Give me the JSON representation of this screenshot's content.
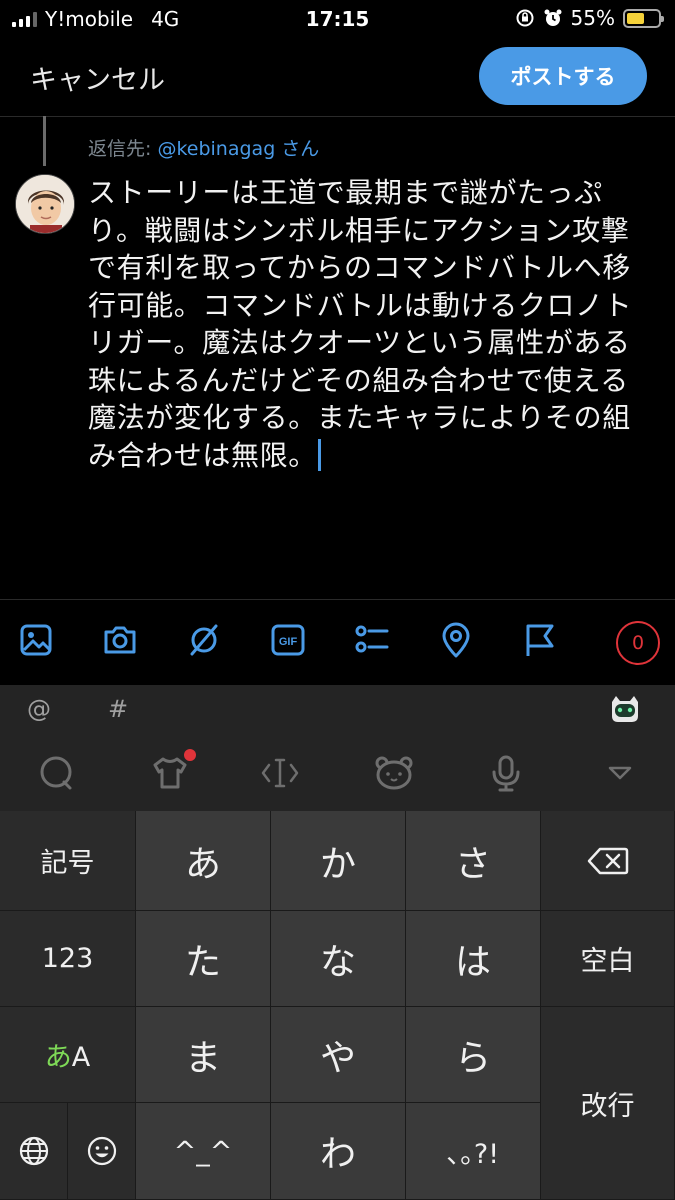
{
  "status_bar": {
    "carrier": "Y!mobile",
    "network": "4G",
    "time": "17:15",
    "battery_percent": "55%",
    "battery_level": 0.55
  },
  "header": {
    "cancel_label": "キャンセル",
    "post_label": "ポストする"
  },
  "reply": {
    "prefix": "返信先: ",
    "handle": "@kebinagag",
    "suffix": " さん"
  },
  "tweet": {
    "text": "ストーリーは王道で最期まで謎がたっぷり。戦闘はシンボル相手にアクション攻撃で有利を取ってからのコマンドバトルへ移行可能。コマンドバトルは動けるクロノトリガー。魔法はクオーツという属性がある珠によるんだけどその組み合わせで使える魔法が変化する。またキャラによりその組み合わせは無限。"
  },
  "toolbar": {
    "icons": [
      "image-icon",
      "camera-icon",
      "circle-slash-icon",
      "gif-icon",
      "poll-icon",
      "location-icon",
      "flag-icon"
    ],
    "char_count": "0",
    "accent_color": "#4a9ae6"
  },
  "keyboard": {
    "at_symbol": "@",
    "hash_symbol": "#",
    "keys": {
      "symbols": "記号",
      "numbers": "123",
      "kana_a": "あ",
      "kana_A": "A",
      "a": "あ",
      "ka": "か",
      "sa": "さ",
      "ta": "た",
      "na": "な",
      "ha": "は",
      "ma": "ま",
      "ya": "や",
      "ra": "ら",
      "emoticon": "^_^",
      "wa": "わ",
      "punct": "､｡?!",
      "space": "空白",
      "enter": "改行"
    }
  }
}
